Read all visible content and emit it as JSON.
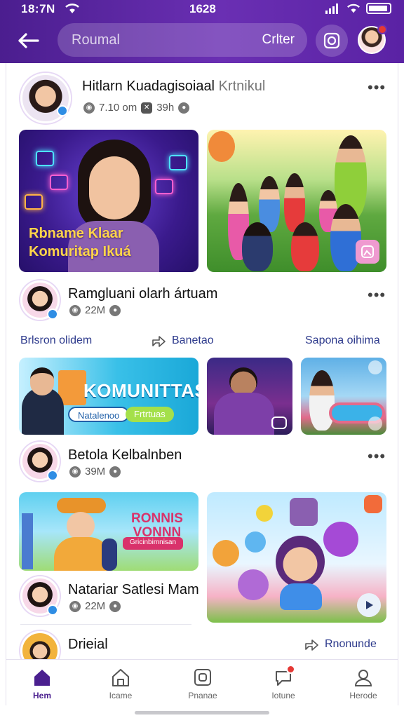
{
  "status_bar": {
    "left_time": "18:7N",
    "center_time": "1628"
  },
  "header": {
    "search_placeholder": "Roumal",
    "filter_label": "Crlter"
  },
  "posts": [
    {
      "name": "Hitlarn Kuadagisoiaal",
      "name_suffix": "Krtnikul",
      "meta_views": "7.10 om",
      "meta_time": "39h"
    },
    {
      "name": "Ramgluani olarh ártuam",
      "meta_count": "22M"
    },
    {
      "name": "Betola Kelbalnben",
      "meta_count": "39M"
    },
    {
      "name": "Natariar Satlesi Mam",
      "meta_count": "22M"
    },
    {
      "name": "Drieial"
    }
  ],
  "tiles": {
    "tile1_caption_line1": "Rbname  Klaar",
    "tile1_caption_line2": "Komuritap Ikuá",
    "tile3_title": "KOMUNITTAS",
    "tile3_pill_left": "Natalenoo",
    "tile3_pill_right": "Frtrtuas",
    "tile6_title_line1": "RONNIS",
    "tile6_title_line2": "VONNN",
    "tile6_subtitle": "Gricinbimnisan"
  },
  "action_row": {
    "left": "Brlsron olidem",
    "middle": "Banetao",
    "right": "Sapona oihima"
  },
  "bottom_action": "Rnonunde",
  "nav": [
    {
      "label": "Hem",
      "icon": "home-icon"
    },
    {
      "label": "Icame",
      "icon": "house-outline-icon"
    },
    {
      "label": "Pnanae",
      "icon": "square-icon"
    },
    {
      "label": "Iotune",
      "icon": "chat-icon"
    },
    {
      "label": "Herode",
      "icon": "profile-icon"
    }
  ],
  "colors": {
    "brand": "#5a24a6",
    "accent_link": "#2d3a8c",
    "badge_red": "#e53935"
  }
}
